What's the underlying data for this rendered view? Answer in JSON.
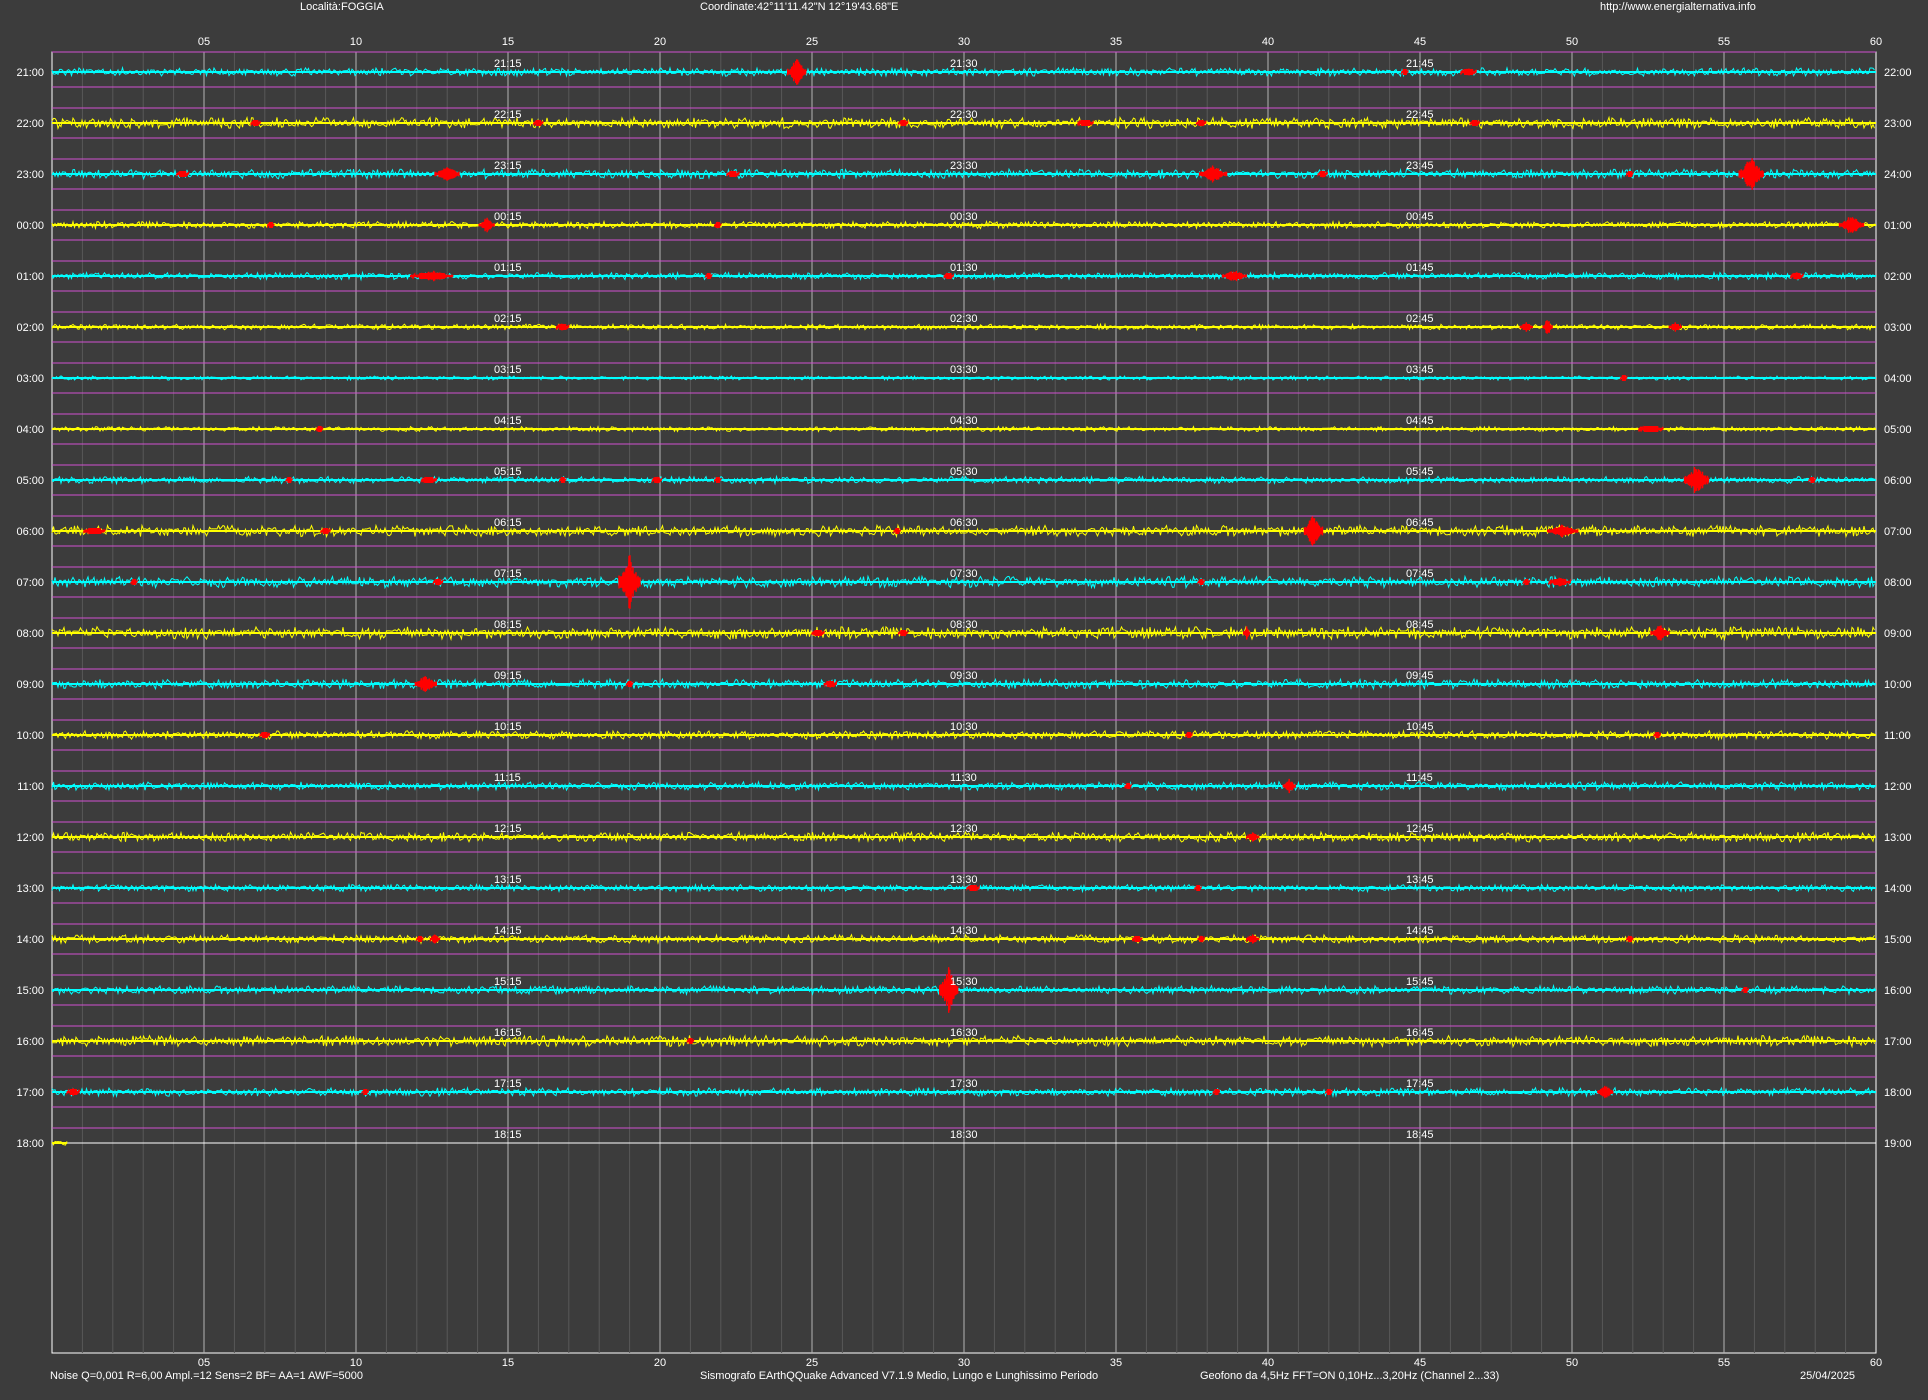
{
  "header": {
    "location": "Località:FOGGIA",
    "coordinates": "Coordinate:42°11'11.42\"N  12°19'43.68\"E",
    "website": "http://www.energialternativa.info"
  },
  "footer": {
    "noise": "Noise Q=0,001 R=6,00 Ampl.=12 Sens=2 BF= AA=1 AWF=5000",
    "software": "Sismografo  EArthQQuake Advanced V7.1.9  Medio, Lungo e Lunghissimo Periodo",
    "geophone": "Geofono da 4,5Hz FFT=ON 0,10Hz...3,20Hz      (Channel 2...33)",
    "date": "25/04/2025"
  },
  "colors": {
    "background": "#3c3c3c",
    "trace_cyan": "#00ffff",
    "trace_yellow": "#ffff00",
    "event": "#ff0000",
    "magenta_grid": "#d050d0",
    "grid": "#8c8c8c",
    "text": "#ffffff"
  },
  "chart_data": {
    "type": "line",
    "x_ticks": [
      "05",
      "10",
      "15",
      "20",
      "25",
      "30",
      "35",
      "40",
      "45",
      "50",
      "55",
      "60"
    ],
    "xlim": [
      0,
      60
    ],
    "grid": true,
    "rows": [
      {
        "left": "21:00",
        "right": "22:00",
        "marks": [
          "21:15",
          "21:30",
          "21:45"
        ],
        "color": "cyan",
        "noise": 0.6,
        "events": [
          {
            "min": 24.5,
            "amp": 14,
            "w": 0.6
          },
          {
            "min": 44.5,
            "amp": 3,
            "w": 0.2
          },
          {
            "min": 46.6,
            "amp": 4,
            "w": 0.5
          }
        ]
      },
      {
        "left": "22:00",
        "right": "23:00",
        "marks": [
          "22:15",
          "22:30",
          "22:45"
        ],
        "color": "yellow",
        "noise": 0.8,
        "events": [
          {
            "min": 6.7,
            "amp": 3,
            "w": 0.3
          },
          {
            "min": 16.0,
            "amp": 3,
            "w": 0.3
          },
          {
            "min": 28.0,
            "amp": 3,
            "w": 0.3
          },
          {
            "min": 34.0,
            "amp": 4,
            "w": 0.5
          },
          {
            "min": 37.8,
            "amp": 3,
            "w": 0.3
          },
          {
            "min": 46.8,
            "amp": 3,
            "w": 0.3
          }
        ]
      },
      {
        "left": "23:00",
        "right": "24:00",
        "marks": [
          "23:15",
          "23:30",
          "23:45"
        ],
        "color": "cyan",
        "noise": 0.7,
        "events": [
          {
            "min": 4.3,
            "amp": 3,
            "w": 0.4
          },
          {
            "min": 13.0,
            "amp": 9,
            "w": 0.8
          },
          {
            "min": 22.4,
            "amp": 3,
            "w": 0.4
          },
          {
            "min": 38.2,
            "amp": 9,
            "w": 0.9
          },
          {
            "min": 41.8,
            "amp": 4,
            "w": 0.3
          },
          {
            "min": 51.9,
            "amp": 3,
            "w": 0.2
          },
          {
            "min": 55.9,
            "amp": 19,
            "w": 0.8
          }
        ]
      },
      {
        "left": "00:00",
        "right": "01:00",
        "marks": [
          "00:15",
          "00:30",
          "00:45"
        ],
        "color": "yellow",
        "noise": 0.5,
        "events": [
          {
            "min": 7.2,
            "amp": 5,
            "w": 0.2
          },
          {
            "min": 14.3,
            "amp": 8,
            "w": 0.5
          },
          {
            "min": 21.9,
            "amp": 3,
            "w": 0.2
          },
          {
            "min": 59.2,
            "amp": 11,
            "w": 0.8
          }
        ]
      },
      {
        "left": "01:00",
        "right": "02:00",
        "marks": [
          "01:15",
          "01:30",
          "01:45"
        ],
        "color": "cyan",
        "noise": 0.5,
        "events": [
          {
            "min": 12.5,
            "amp": 6,
            "w": 1.4
          },
          {
            "min": 21.6,
            "amp": 3,
            "w": 0.2
          },
          {
            "min": 29.5,
            "amp": 3,
            "w": 0.3
          },
          {
            "min": 38.9,
            "amp": 7,
            "w": 0.8
          },
          {
            "min": 57.4,
            "amp": 4,
            "w": 0.4
          }
        ]
      },
      {
        "left": "02:00",
        "right": "03:00",
        "marks": [
          "02:15",
          "02:30",
          "02:45"
        ],
        "color": "yellow",
        "noise": 0.4,
        "events": [
          {
            "min": 16.8,
            "amp": 4,
            "w": 0.4
          },
          {
            "min": 48.5,
            "amp": 6,
            "w": 0.4
          },
          {
            "min": 49.2,
            "amp": 9,
            "w": 0.3
          },
          {
            "min": 53.4,
            "amp": 5,
            "w": 0.4
          }
        ]
      },
      {
        "left": "03:00",
        "right": "04:00",
        "marks": [
          "03:15",
          "03:30",
          "03:45"
        ],
        "color": "cyan",
        "noise": 0.3,
        "events": [
          {
            "min": 51.7,
            "amp": 3,
            "w": 0.2
          }
        ]
      },
      {
        "left": "04:00",
        "right": "05:00",
        "marks": [
          "04:15",
          "04:30",
          "04:45"
        ],
        "color": "yellow",
        "noise": 0.35,
        "events": [
          {
            "min": 8.8,
            "amp": 3,
            "w": 0.2
          },
          {
            "min": 52.6,
            "amp": 4,
            "w": 0.8
          }
        ]
      },
      {
        "left": "05:00",
        "right": "06:00",
        "marks": [
          "05:15",
          "05:30",
          "05:45"
        ],
        "color": "cyan",
        "noise": 0.5,
        "events": [
          {
            "min": 7.8,
            "amp": 3,
            "w": 0.2
          },
          {
            "min": 12.4,
            "amp": 3,
            "w": 0.5
          },
          {
            "min": 16.8,
            "amp": 3,
            "w": 0.2
          },
          {
            "min": 19.9,
            "amp": 4,
            "w": 0.3
          },
          {
            "min": 21.9,
            "amp": 3,
            "w": 0.2
          },
          {
            "min": 54.1,
            "amp": 17,
            "w": 0.8
          },
          {
            "min": 57.9,
            "amp": 3,
            "w": 0.2
          }
        ]
      },
      {
        "left": "06:00",
        "right": "07:00",
        "marks": [
          "06:15",
          "06:30",
          "06:45"
        ],
        "color": "yellow",
        "noise": 0.8,
        "events": [
          {
            "min": 1.4,
            "amp": 3,
            "w": 0.7
          },
          {
            "min": 9.0,
            "amp": 3,
            "w": 0.3
          },
          {
            "min": 27.8,
            "amp": 3,
            "w": 0.2
          },
          {
            "min": 41.5,
            "amp": 20,
            "w": 0.6
          },
          {
            "min": 49.7,
            "amp": 7,
            "w": 1.0
          }
        ]
      },
      {
        "left": "07:00",
        "right": "08:00",
        "marks": [
          "07:15",
          "07:30",
          "07:45"
        ],
        "color": "cyan",
        "noise": 0.8,
        "events": [
          {
            "min": 2.7,
            "amp": 3,
            "w": 0.2
          },
          {
            "min": 12.7,
            "amp": 4,
            "w": 0.3
          },
          {
            "min": 19.0,
            "amp": 28,
            "w": 0.7
          },
          {
            "min": 37.8,
            "amp": 3,
            "w": 0.2
          },
          {
            "min": 48.5,
            "amp": 3,
            "w": 0.2
          },
          {
            "min": 49.6,
            "amp": 5,
            "w": 0.7
          }
        ]
      },
      {
        "left": "08:00",
        "right": "09:00",
        "marks": [
          "08:15",
          "08:30",
          "08:45"
        ],
        "color": "yellow",
        "noise": 0.9,
        "events": [
          {
            "min": 25.2,
            "amp": 3,
            "w": 0.4
          },
          {
            "min": 28.0,
            "amp": 3,
            "w": 0.3
          },
          {
            "min": 39.3,
            "amp": 7,
            "w": 0.2
          },
          {
            "min": 52.9,
            "amp": 9,
            "w": 0.6
          }
        ]
      },
      {
        "left": "09:00",
        "right": "10:00",
        "marks": [
          "09:15",
          "09:30",
          "09:45"
        ],
        "color": "cyan",
        "noise": 0.7,
        "events": [
          {
            "min": 12.3,
            "amp": 11,
            "w": 0.7
          },
          {
            "min": 19.0,
            "amp": 3,
            "w": 0.2
          },
          {
            "min": 25.6,
            "amp": 4,
            "w": 0.4
          }
        ]
      },
      {
        "left": "10:00",
        "right": "11:00",
        "marks": [
          "10:15",
          "10:30",
          "10:45"
        ],
        "color": "yellow",
        "noise": 0.6,
        "events": [
          {
            "min": 7.0,
            "amp": 4,
            "w": 0.3
          },
          {
            "min": 37.4,
            "amp": 3,
            "w": 0.2
          },
          {
            "min": 52.8,
            "amp": 3,
            "w": 0.2
          }
        ]
      },
      {
        "left": "11:00",
        "right": "12:00",
        "marks": [
          "11:15",
          "11:30",
          "11:45"
        ],
        "color": "cyan",
        "noise": 0.6,
        "events": [
          {
            "min": 35.4,
            "amp": 3,
            "w": 0.2
          },
          {
            "min": 40.7,
            "amp": 8,
            "w": 0.4
          }
        ]
      },
      {
        "left": "12:00",
        "right": "13:00",
        "marks": [
          "12:15",
          "12:30",
          "12:45"
        ],
        "color": "yellow",
        "noise": 0.7,
        "events": [
          {
            "min": 39.5,
            "amp": 5,
            "w": 0.4
          }
        ]
      },
      {
        "left": "13:00",
        "right": "14:00",
        "marks": [
          "13:15",
          "13:30",
          "13:45"
        ],
        "color": "cyan",
        "noise": 0.5,
        "events": [
          {
            "min": 30.3,
            "amp": 4,
            "w": 0.4
          },
          {
            "min": 37.7,
            "amp": 3,
            "w": 0.2
          }
        ]
      },
      {
        "left": "14:00",
        "right": "15:00",
        "marks": [
          "14:15",
          "14:30",
          "14:45"
        ],
        "color": "yellow",
        "noise": 0.6,
        "events": [
          {
            "min": 12.1,
            "amp": 3,
            "w": 0.2
          },
          {
            "min": 12.6,
            "amp": 6,
            "w": 0.3
          },
          {
            "min": 35.7,
            "amp": 3,
            "w": 0.3
          },
          {
            "min": 37.8,
            "amp": 4,
            "w": 0.2
          },
          {
            "min": 39.5,
            "amp": 5,
            "w": 0.4
          },
          {
            "min": 51.9,
            "amp": 3,
            "w": 0.2
          }
        ]
      },
      {
        "left": "15:00",
        "right": "16:00",
        "marks": [
          "15:15",
          "15:30",
          "15:45"
        ],
        "color": "cyan",
        "noise": 0.6,
        "events": [
          {
            "min": 29.5,
            "amp": 25,
            "w": 0.6
          },
          {
            "min": 55.7,
            "amp": 3,
            "w": 0.2
          }
        ]
      },
      {
        "left": "16:00",
        "right": "17:00",
        "marks": [
          "16:15",
          "16:30",
          "16:45"
        ],
        "color": "yellow",
        "noise": 0.8,
        "events": [
          {
            "min": 21.0,
            "amp": 3,
            "w": 0.2
          }
        ]
      },
      {
        "left": "17:00",
        "right": "18:00",
        "marks": [
          "17:15",
          "17:30",
          "17:45"
        ],
        "color": "cyan",
        "noise": 0.6,
        "events": [
          {
            "min": 0.7,
            "amp": 4,
            "w": 0.4
          },
          {
            "min": 10.3,
            "amp": 3,
            "w": 0.2
          },
          {
            "min": 38.3,
            "amp": 3,
            "w": 0.2
          },
          {
            "min": 42.0,
            "amp": 3,
            "w": 0.2
          },
          {
            "min": 51.1,
            "amp": 8,
            "w": 0.5
          }
        ]
      },
      {
        "left": "18:00",
        "right": "19:00",
        "marks": [
          "18:15",
          "18:30",
          "18:45"
        ],
        "color": "yellow",
        "noise": 0.6,
        "events": [],
        "progress": 0.5
      }
    ]
  }
}
